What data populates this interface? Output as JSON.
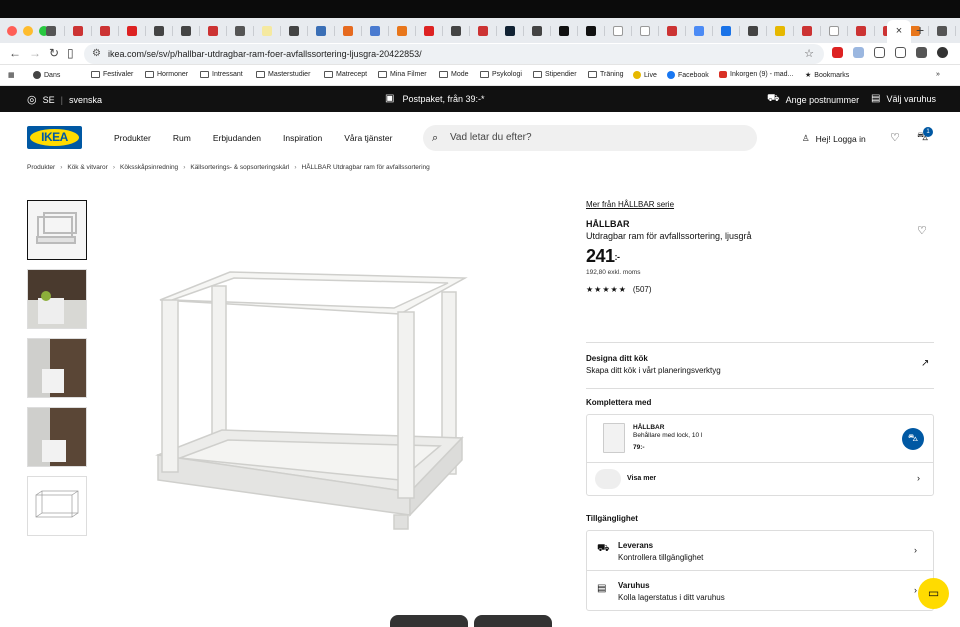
{
  "browser": {
    "url": "ikea.com/se/sv/p/hallbar-utdragbar-ram-foer-avfallssortering-ljusgra-20422853/",
    "active_tab_close": "×",
    "new_tab": "+"
  },
  "bookmarks": [
    {
      "label": "Dans"
    },
    {
      "label": "Festivaler"
    },
    {
      "label": "Hormoner"
    },
    {
      "label": "Intressant"
    },
    {
      "label": "Masterstudier"
    },
    {
      "label": "Matrecept"
    },
    {
      "label": "Mina Filmer"
    },
    {
      "label": "Mode"
    },
    {
      "label": "Psykologi"
    },
    {
      "label": "Stipendier"
    },
    {
      "label": "Träning"
    },
    {
      "label": "Live"
    },
    {
      "label": "Facebook"
    },
    {
      "label": "Inkorgen (9) - mad..."
    },
    {
      "label": "Bookmarks"
    }
  ],
  "topbar": {
    "country": "SE",
    "language": "svenska",
    "shipping": "Postpaket, från 39:-*",
    "postcode": "Ange postnummer",
    "store": "Välj varuhus"
  },
  "header": {
    "logo": "IKEA",
    "nav": [
      "Produkter",
      "Rum",
      "Erbjudanden",
      "Inspiration",
      "Våra tjänster"
    ],
    "search_placeholder": "Vad letar du efter?",
    "login": "Hej! Logga in",
    "cart_count": "1"
  },
  "breadcrumbs": [
    "Produkter",
    "Kök & vitvaror",
    "Köksskåpsinredning",
    "Källsorterings- & sopsorteringskärl",
    "HÅLLBAR Utdragbar ram för avfallssortering"
  ],
  "product": {
    "more_link": "Mer från HÅLLBAR serie",
    "name": "HÅLLBAR",
    "description": "Utdragbar ram för avfallssortering, ljusgrå",
    "price": "241",
    "price_suffix": ":-",
    "price_ex_vat": "192,80 exkl. moms",
    "stars": "★★★★★",
    "rating_count": "(507)"
  },
  "design": {
    "title": "Designa ditt kök",
    "subtitle": "Skapa ditt kök i vårt planeringsverktyg"
  },
  "complement": {
    "heading": "Komplettera med",
    "item_name": "HÅLLBAR",
    "item_desc": "Behållare med lock, 10 l",
    "item_price": "79:-",
    "see_more": "Visa mer"
  },
  "availability": {
    "heading": "Tillgänglighet",
    "delivery_title": "Leverans",
    "delivery_sub": "Kontrollera tillgänglighet",
    "store_title": "Varuhus",
    "store_sub": "Kolla lagerstatus i ditt varuhus"
  },
  "colors": {
    "ikea_blue": "#0058a3",
    "ikea_yellow": "#ffdb00"
  }
}
